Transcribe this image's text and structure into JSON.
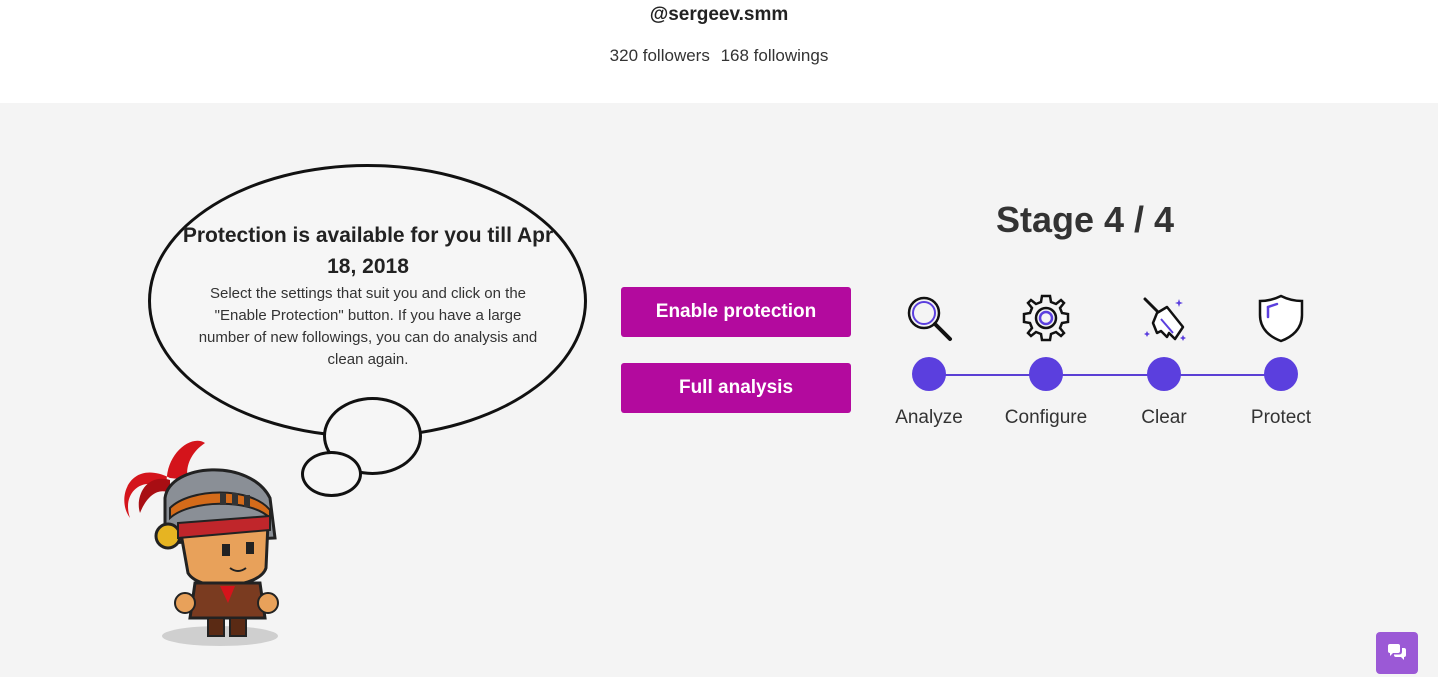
{
  "profile": {
    "username": "@sergeev.smm",
    "followers": "320 followers",
    "followings": "168 followings"
  },
  "bubble": {
    "title": "Protection is available for you till Apr 18, 2018",
    "text": "Select the settings that suit you and click on the \"Enable Protection\" button. If you have a large number of new followings, you can do analysis and clean again."
  },
  "actions": {
    "enable_label": "Enable protection",
    "full_analysis_label": "Full analysis"
  },
  "stage": {
    "title": "Stage 4 / 4",
    "steps": [
      {
        "label": "Analyze",
        "icon": "magnifier-icon"
      },
      {
        "label": "Configure",
        "icon": "gear-icon"
      },
      {
        "label": "Clear",
        "icon": "broom-icon"
      },
      {
        "label": "Protect",
        "icon": "shield-icon"
      }
    ]
  },
  "colors": {
    "accent_button": "#b30a9e",
    "step_dot": "#5b3fde",
    "chat_button": "#9b59d6"
  },
  "chat": {
    "icon": "chat-icon"
  }
}
